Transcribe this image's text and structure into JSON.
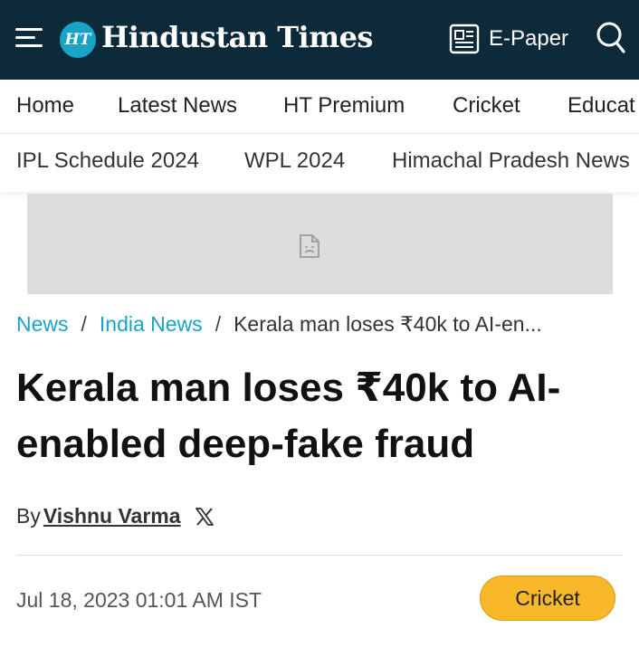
{
  "header": {
    "logo_badge": "HT",
    "logo_text": "Hindustan Times",
    "epaper_label": "E-Paper",
    "background_color": "#0d2a3a",
    "accent_color": "#1aa3c8"
  },
  "nav_primary": [
    "Home",
    "Latest News",
    "HT Premium",
    "Cricket",
    "Educat"
  ],
  "nav_secondary": [
    "IPL Schedule 2024",
    "WPL 2024",
    "Himachal Pradesh News"
  ],
  "breadcrumb": {
    "items": [
      "News",
      "India News"
    ],
    "separator": "/",
    "current": "Kerala man loses ₹40k to AI-en..."
  },
  "article": {
    "headline": "Kerala man loses ₹40k to AI-enabled deep-fake fraud",
    "by_prefix": "By",
    "author": "Vishnu Varma",
    "timestamp": "Jul 18, 2023 01:01 AM IST",
    "tag": "Cricket",
    "tag_color": "#f9b829"
  },
  "icons": [
    "hamburger-menu-icon",
    "epaper-icon",
    "search-icon",
    "broken-image-icon",
    "x-social-icon"
  ]
}
